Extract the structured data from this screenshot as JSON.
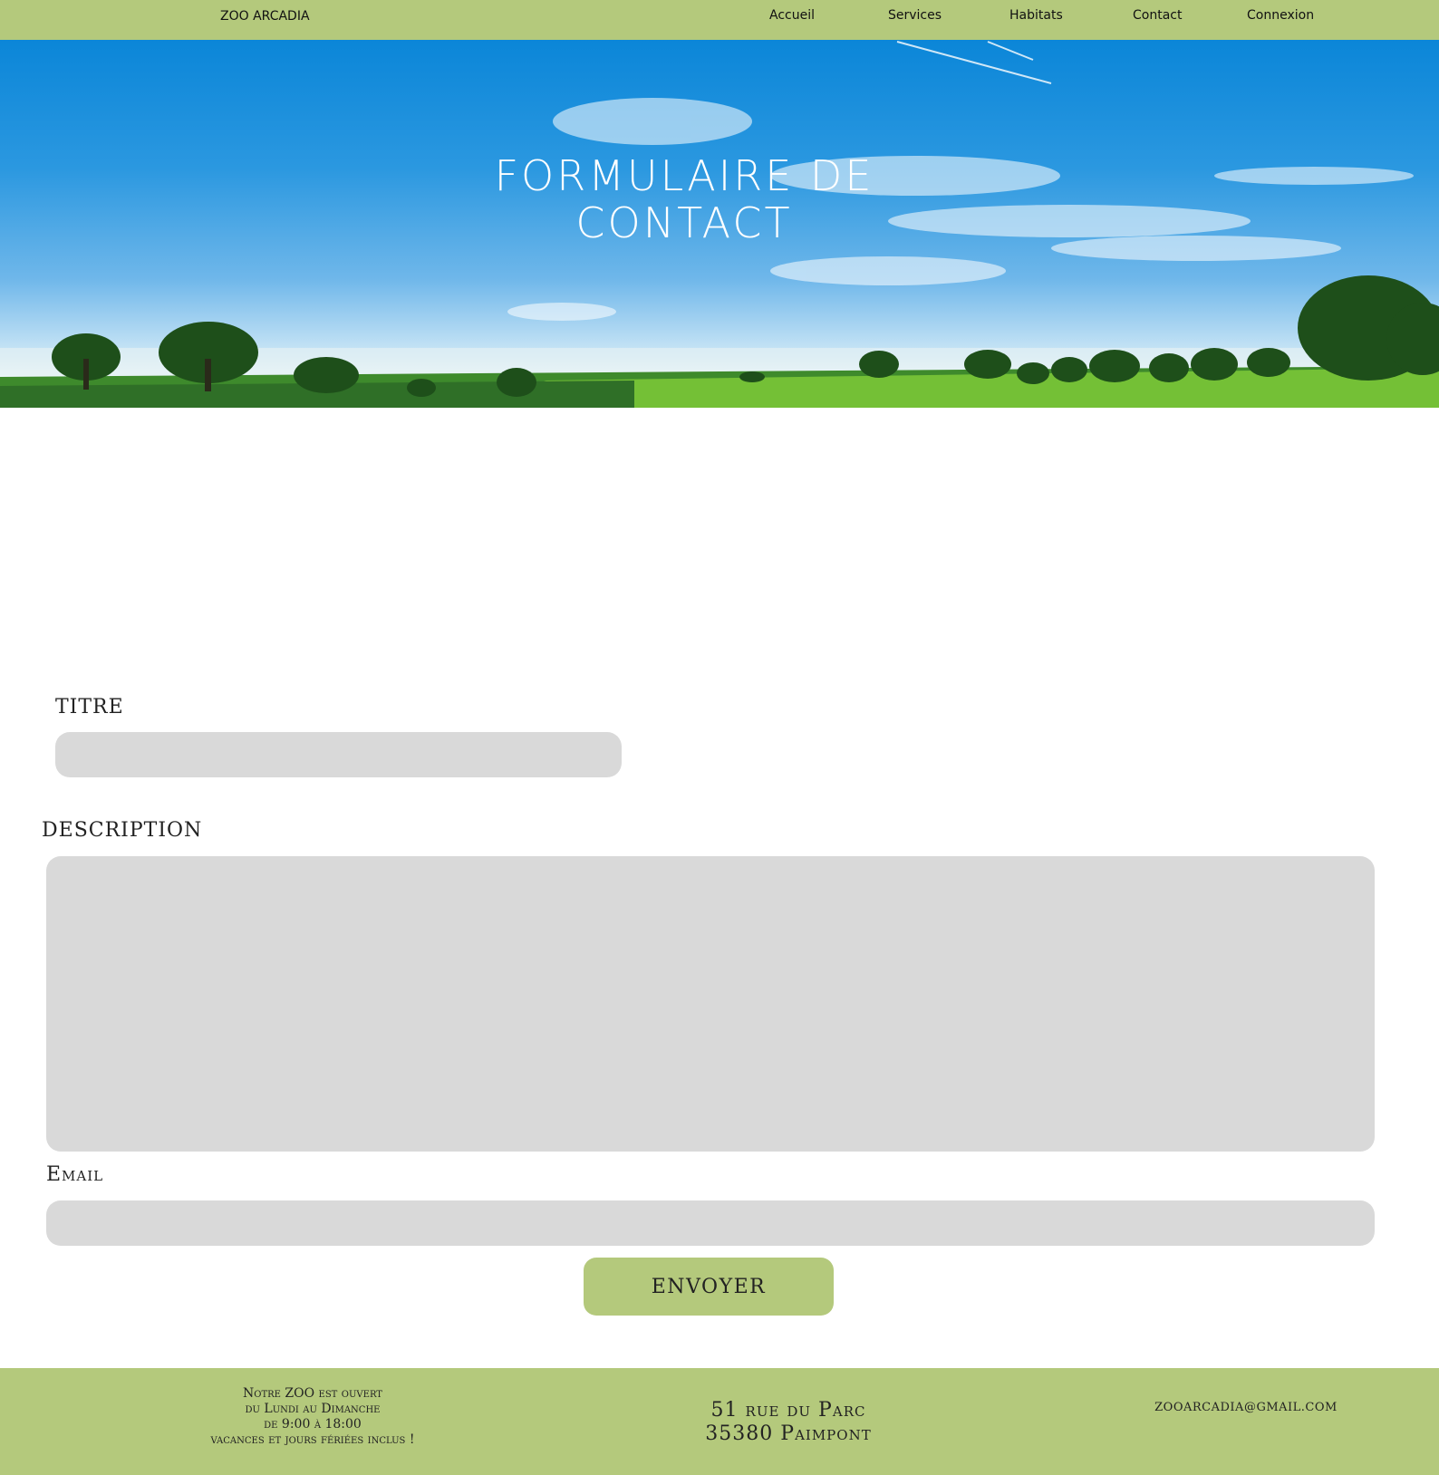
{
  "nav": {
    "brand": "ZOO ARCADIA",
    "links": [
      "Accueil",
      "Services",
      "Habitats",
      "Contact",
      "Connexion"
    ]
  },
  "hero": {
    "title_line1": "FORMULAIRE DE",
    "title_line2": "CONTACT"
  },
  "form": {
    "title_label": "TITRE",
    "title_value": "",
    "description_label": "DESCRIPTION",
    "description_value": "",
    "email_label": "Email",
    "email_value": "",
    "submit_label": "ENVOYER"
  },
  "footer": {
    "hours": [
      "Notre ZOO est ouvert",
      "du Lundi au Dimanche",
      "de 9:00 à 18:00",
      "vacances et jours fériées inclus !"
    ],
    "address": [
      "51 rue du Parc",
      "35380 Paimpont"
    ],
    "email": "zooarcadia@gmail.com"
  },
  "colors": {
    "accent": "#b4c97c",
    "field": "#d9d9d9",
    "sky": "#0b86d8"
  }
}
